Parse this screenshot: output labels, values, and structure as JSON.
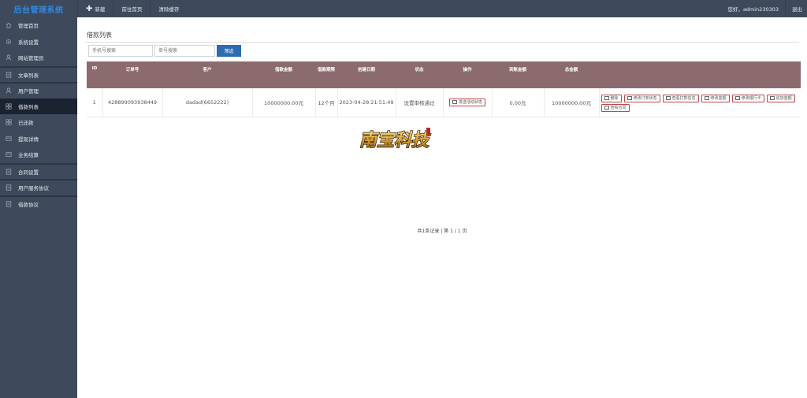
{
  "brand": "后台管理系统",
  "topnav": [
    {
      "label": "新建",
      "plus": "✚"
    },
    {
      "label": "前往首页"
    },
    {
      "label": "清除缓存"
    }
  ],
  "greeting": "您好，admin230303",
  "logout": "退出",
  "sidebar": [
    {
      "label": "管理首页",
      "icon": "home-icon"
    },
    {
      "label": "系统设置",
      "icon": "gear-icon"
    },
    {
      "label": "网站管理员",
      "icon": "user-icon"
    },
    {
      "label": "文章列表",
      "icon": "document-icon"
    },
    {
      "label": "用户管理",
      "icon": "user-icon"
    },
    {
      "label": "借款列表",
      "icon": "grid-icon"
    },
    {
      "label": "已还款",
      "icon": "grid-icon"
    },
    {
      "label": "提现详情",
      "icon": "card-icon"
    },
    {
      "label": "业务结算",
      "icon": "card-icon"
    },
    {
      "label": "合同设置",
      "icon": "document-icon"
    },
    {
      "label": "用户服务协议",
      "icon": "document-icon"
    },
    {
      "label": "借款协议",
      "icon": "document-icon"
    }
  ],
  "page": {
    "title": "借款列表",
    "search": {
      "phone_placeholder": "手机号搜索",
      "order_placeholder": "单号搜索",
      "button": "筛选"
    },
    "columns": [
      "ID",
      "订单号",
      "客户",
      "借款金额",
      "借款期限",
      "创建日期",
      "状态",
      "操作",
      "到账金额",
      "总金额"
    ],
    "rows": [
      {
        "id": "1",
        "order_no": "428899093938449",
        "customer": "dadad(6652222)",
        "amount": "10000000.00元",
        "term": "12个月",
        "created": "2023-04-28 21:51:49",
        "status": "设置审核通过",
        "op_button": "发送活动状态",
        "received": "0.00元",
        "total": "10000000.00元",
        "actions": [
          "删除",
          "修改订单状态",
          "查看打款信息",
          "修改金额",
          "修改银行卡",
          "追加金额",
          "查看合同"
        ]
      }
    ],
    "pager": "共1条记录 | 第 1 / 1 页"
  },
  "logo_text": "南宝科技",
  "colors": {
    "topbar": "#3e4a5b",
    "brand": "#2f8ae0",
    "table_header": "#8b6b6e",
    "search_button": "#2b6cb3",
    "status_text": "#d9534f"
  }
}
